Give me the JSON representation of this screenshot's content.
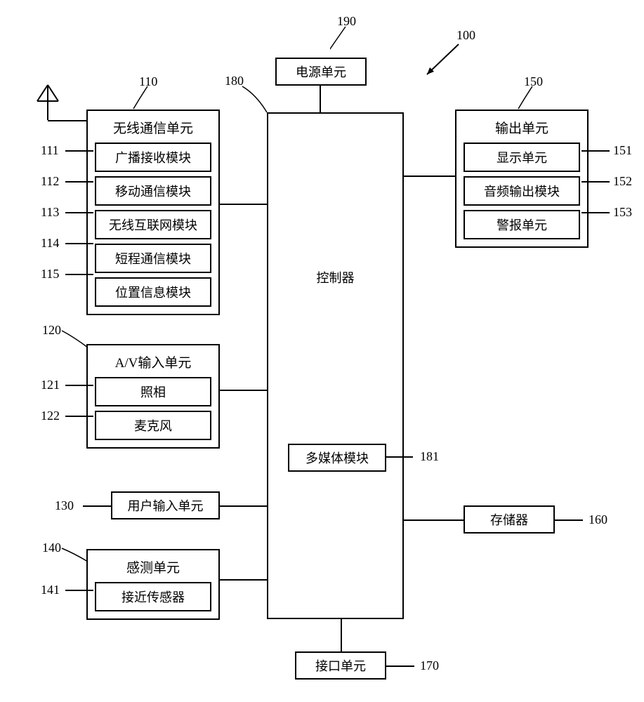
{
  "refs": {
    "r100": "100",
    "r190": "190",
    "r180": "180",
    "r110": "110",
    "r111": "111",
    "r112": "112",
    "r113": "113",
    "r114": "114",
    "r115": "115",
    "r120": "120",
    "r121": "121",
    "r122": "122",
    "r130": "130",
    "r140": "140",
    "r141": "141",
    "r150": "150",
    "r151": "151",
    "r152": "152",
    "r153": "153",
    "r160": "160",
    "r170": "170",
    "r181": "181"
  },
  "blocks": {
    "power": "电源单元",
    "controller": "控制器",
    "multimedia": "多媒体模块",
    "wireless": {
      "title": "无线通信单元",
      "broadcast": "广播接收模块",
      "mobile": "移动通信模块",
      "internet": "无线互联网模块",
      "short_range": "短程通信模块",
      "location": "位置信息模块"
    },
    "av": {
      "title": "A/V输入单元",
      "camera": "照相",
      "mic": "麦克风"
    },
    "user_input": "用户输入单元",
    "sensing": {
      "title": "感测单元",
      "proximity": "接近传感器"
    },
    "output": {
      "title": "输出单元",
      "display": "显示单元",
      "audio": "音频输出模块",
      "alarm": "警报单元"
    },
    "memory": "存储器",
    "interface": "接口单元"
  }
}
